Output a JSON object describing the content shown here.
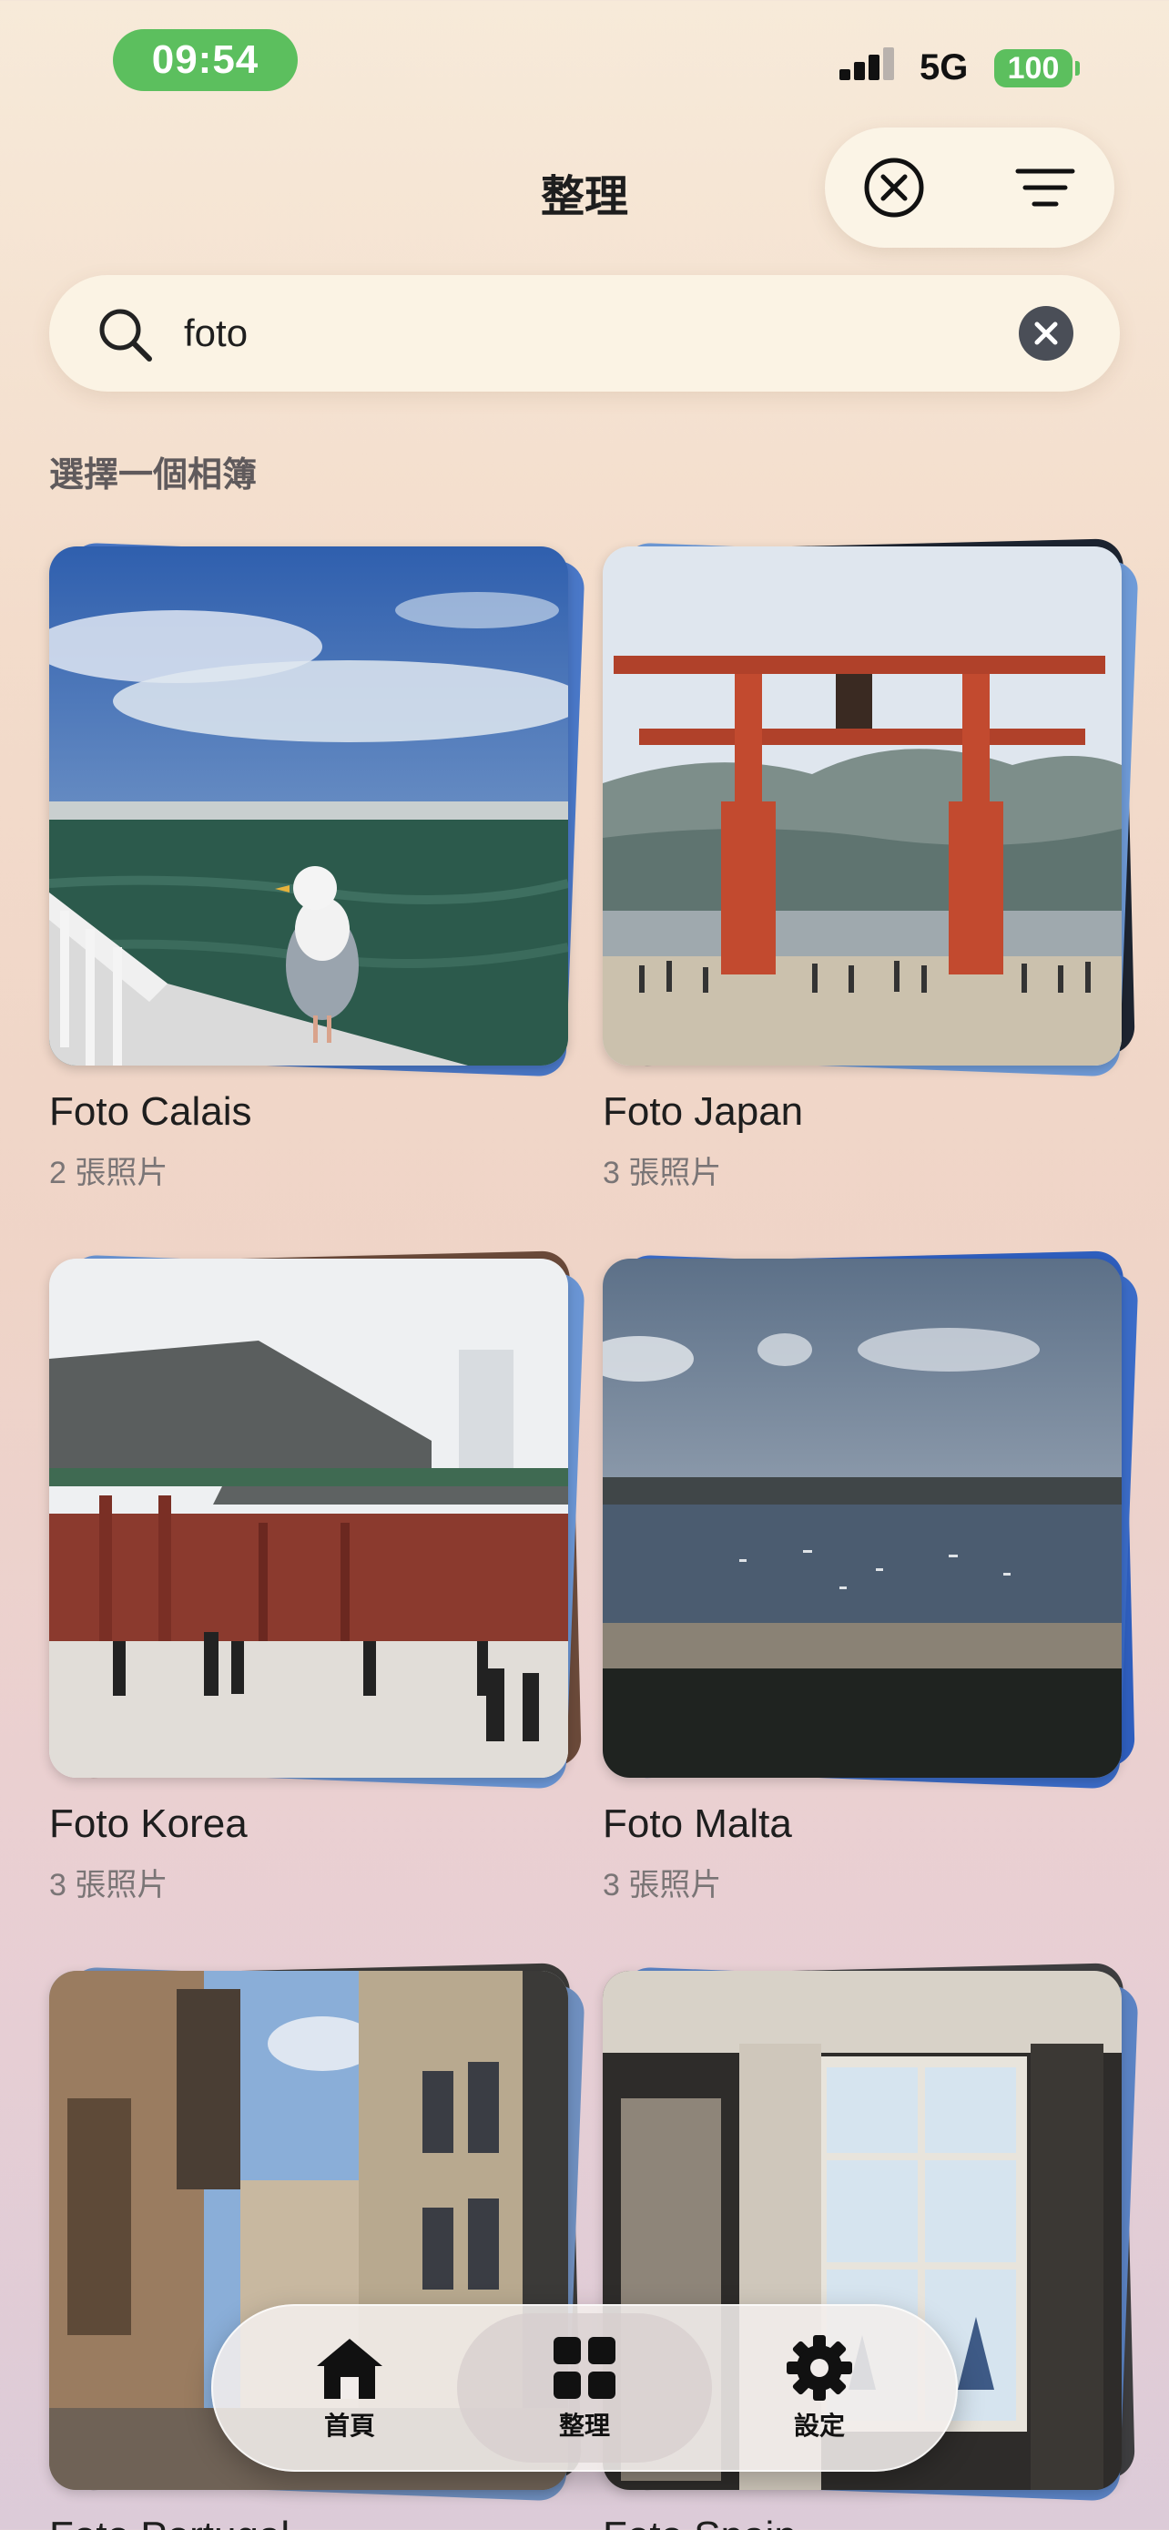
{
  "status_bar": {
    "time": "09:54",
    "network": "5G",
    "battery": "100"
  },
  "header": {
    "title": "整理"
  },
  "search": {
    "value": "foto"
  },
  "section_label": "選擇一個相簿",
  "albums": [
    {
      "name": "Foto Calais",
      "count": "2 張照片"
    },
    {
      "name": "Foto Japan",
      "count": "3 張照片"
    },
    {
      "name": "Foto Korea",
      "count": "3 張照片"
    },
    {
      "name": "Foto Malta",
      "count": "3 張照片"
    },
    {
      "name": "Foto Portugal",
      "count": ""
    },
    {
      "name": "Foto Spain",
      "count": ""
    }
  ],
  "tabbar": {
    "items": [
      {
        "label": "首頁",
        "icon": "house-icon"
      },
      {
        "label": "整理",
        "icon": "grid-icon",
        "active": true
      },
      {
        "label": "設定",
        "icon": "gear-icon"
      }
    ]
  },
  "colors": {
    "status_green": "#5cbf5e",
    "background_top": "#f7ead9",
    "background_bottom": "#dccbd8"
  }
}
